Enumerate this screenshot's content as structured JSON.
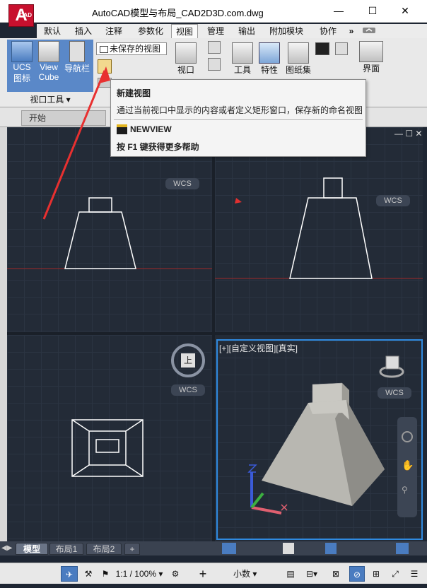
{
  "app": {
    "title": "AutoCAD模型与布局_CAD2D3D.com.dwg",
    "logo_letter": "A",
    "logo_sub": "CAD"
  },
  "window_controls": {
    "minimize": "—",
    "maximize": "☐",
    "close": "✕"
  },
  "ribbon_tabs": [
    "默认",
    "插入",
    "注释",
    "参数化",
    "视图",
    "管理",
    "输出",
    "附加模块",
    "协作"
  ],
  "ribbon_tabs_active": "视图",
  "ribbon_more": "»",
  "ribbon": {
    "ucs_label_1": "UCS",
    "ucs_label_2": "图标",
    "viewcube_label_1": "View",
    "viewcube_label_2": "Cube",
    "navbar_label": "导航栏",
    "group_label": "视口工具",
    "view_dropdown": "未保存的视图",
    "viewport_label": "视口",
    "tools_label": "工具",
    "props_label": "特性",
    "sheetset_label": "图纸集",
    "interface_label": "界面"
  },
  "doc_tab": {
    "start": "开始"
  },
  "tooltip": {
    "title": "新建视图",
    "description": "通过当前视口中显示的内容或者定义矩形窗口，保存新的命名视图",
    "command": "NEWVIEW",
    "help": "按 F1 键获得更多帮助"
  },
  "viewports": {
    "active_label": "[+][自定义视图][真实]",
    "wcs": "WCS",
    "top_cube_label": "上"
  },
  "layout_tabs": [
    "模型",
    "布局1",
    "布局2"
  ],
  "layout_tabs_active": "模型",
  "layout_add": "+",
  "status": {
    "scale": "1:1 / 100%",
    "units": "小数"
  },
  "colors": {
    "accent_blue": "#4a7cc0",
    "autocad_red": "#c8102e",
    "canvas": "#232b37",
    "arrow_red": "#e83030"
  }
}
